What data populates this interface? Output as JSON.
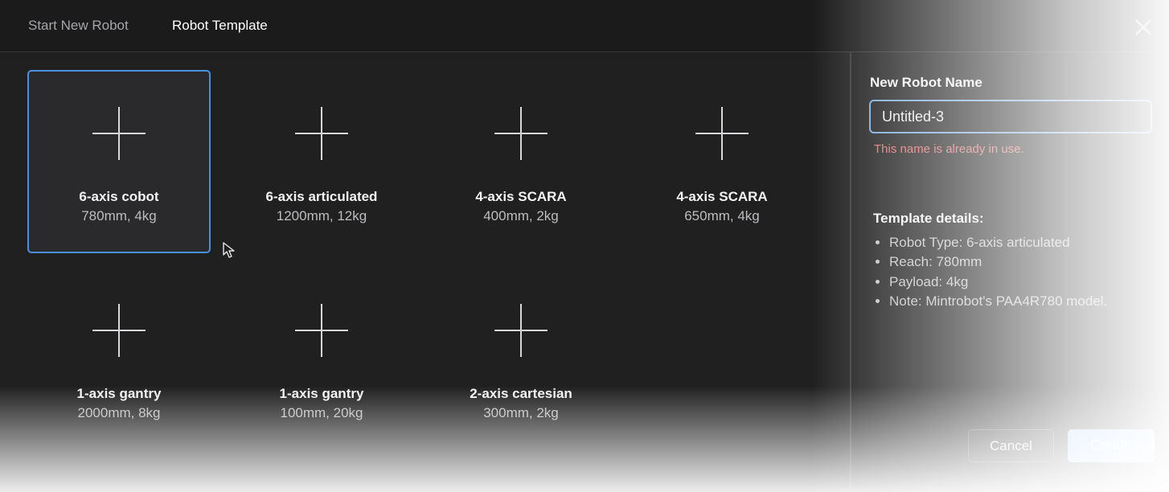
{
  "tabs": [
    {
      "label": "Start New Robot"
    },
    {
      "label": "Robot Template"
    }
  ],
  "templates": [
    {
      "name": "6-axis cobot",
      "spec": "780mm, 4kg",
      "selected": true
    },
    {
      "name": "6-axis articulated",
      "spec": "1200mm, 12kg"
    },
    {
      "name": "4-axis SCARA",
      "spec": "400mm, 2kg"
    },
    {
      "name": "4-axis SCARA",
      "spec": "650mm, 4kg"
    },
    {
      "name": "1-axis gantry",
      "spec": "2000mm, 8kg"
    },
    {
      "name": "1-axis gantry",
      "spec": "100mm, 20kg"
    },
    {
      "name": "2-axis cartesian",
      "spec": "300mm, 2kg"
    }
  ],
  "form": {
    "label": "New Robot Name",
    "value": "Untitled-3",
    "error": "This name is already in use."
  },
  "details": {
    "title": "Template details:",
    "items": [
      "Robot Type: 6-axis articulated",
      "Reach: 780mm",
      "Payload: 4kg",
      "Note: Mintrobot's PAA4R780 model."
    ]
  },
  "buttons": {
    "cancel": "Cancel",
    "create": "Create"
  },
  "icons": {
    "close": "close-icon",
    "add": "plus-icon",
    "cursor": "mouse-pointer-icon"
  },
  "colors": {
    "accent": "#4a8fe0",
    "error": "#e06f6f",
    "background": "#1f1f20"
  }
}
